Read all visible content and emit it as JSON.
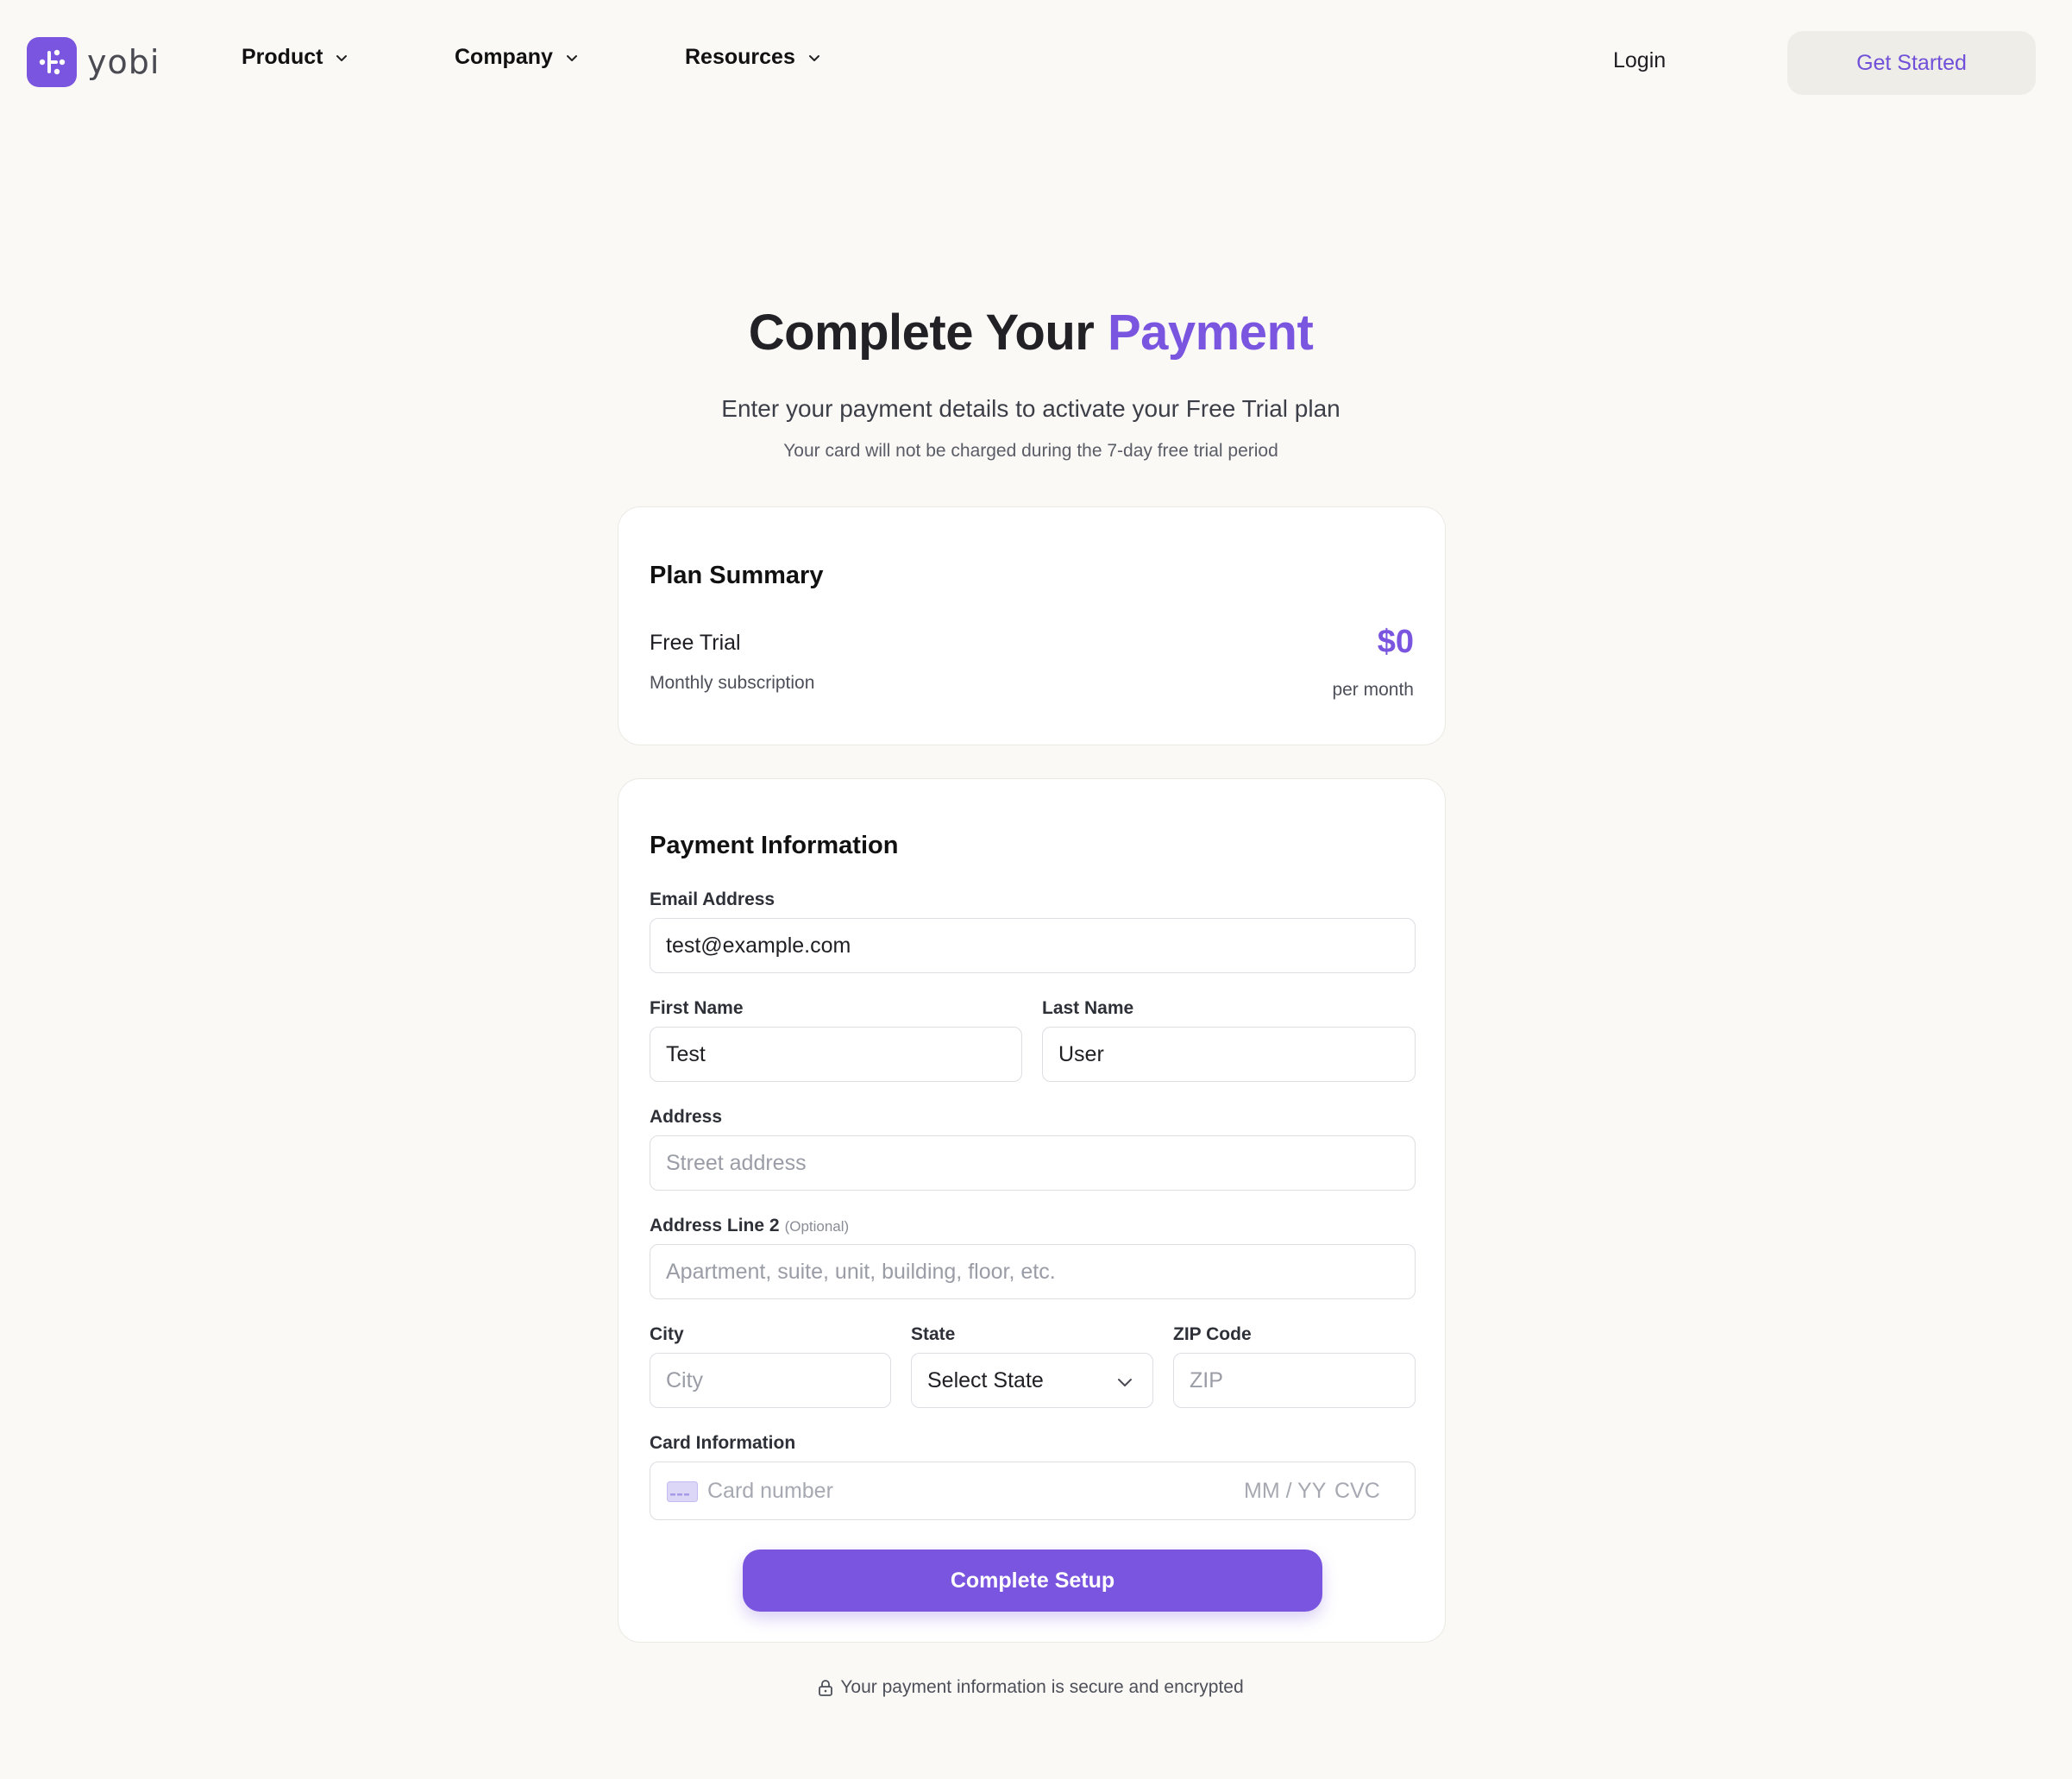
{
  "brand": {
    "name": "yobi",
    "accent": "#7a55df"
  },
  "nav": {
    "items": [
      {
        "label": "Product"
      },
      {
        "label": "Company"
      },
      {
        "label": "Resources"
      }
    ],
    "login": "Login",
    "cta": "Get Started"
  },
  "hero": {
    "title_main": "Complete Your",
    "title_accent": "Payment",
    "subtitle": "Enter your payment details to activate your Free Trial plan",
    "note": "Your card will not be charged during the 7-day free trial period"
  },
  "plan": {
    "heading": "Plan Summary",
    "name": "Free Trial",
    "description": "Monthly subscription",
    "price": "$0",
    "period": "per month"
  },
  "payment": {
    "heading": "Payment Information",
    "email": {
      "label": "Email Address",
      "value": "test@example.com",
      "placeholder": ""
    },
    "first_name": {
      "label": "First Name",
      "value": "Test"
    },
    "last_name": {
      "label": "Last Name",
      "value": "User"
    },
    "address": {
      "label": "Address",
      "placeholder": "Street address"
    },
    "address2": {
      "label": "Address Line 2",
      "optional": "(Optional)",
      "placeholder": "Apartment, suite, unit, building, floor, etc."
    },
    "city": {
      "label": "City",
      "placeholder": "City"
    },
    "state": {
      "label": "State",
      "selected": "Select State"
    },
    "zip": {
      "label": "ZIP Code",
      "placeholder": "ZIP"
    },
    "card": {
      "label": "Card Information",
      "number_placeholder": "Card number",
      "expiry_placeholder": "MM / YY",
      "cvc_placeholder": "CVC"
    },
    "submit": "Complete Setup"
  },
  "footer": {
    "secure_note": "Your payment information is secure and encrypted"
  }
}
